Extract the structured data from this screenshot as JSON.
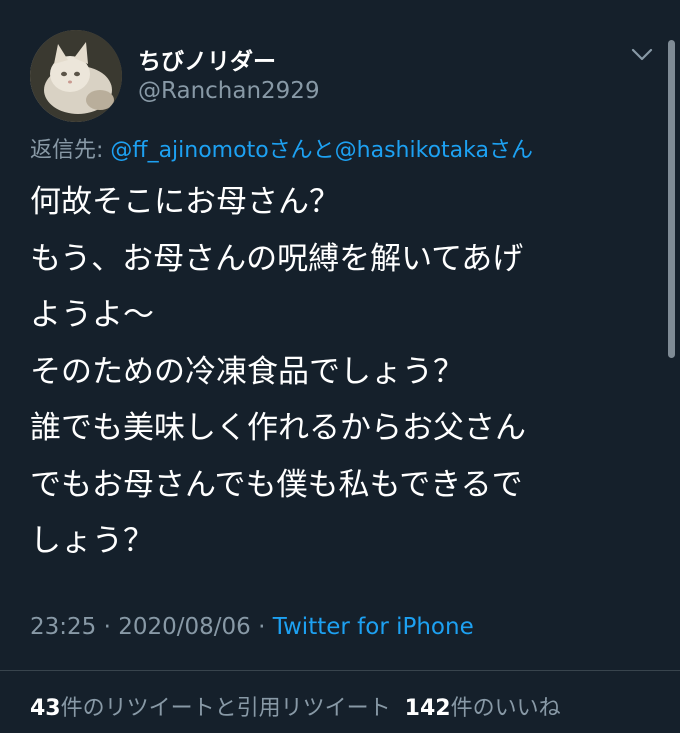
{
  "user": {
    "display_name": "ちびノリダー",
    "handle": "@Ranchan2929"
  },
  "icons": {
    "avatar": "cat-photo-avatar",
    "more": "chevron-down-icon"
  },
  "reply": {
    "prefix": "返信先: ",
    "mention1": "@ff_ajinomoto",
    "san1": "さんと",
    "mention2": "@hashikotaka",
    "san2": "さん"
  },
  "body_lines": [
    "何故そこにお母さん？",
    "もう、お母さんの呪縛を解いてあげ",
    "ようよ〜",
    "そのための冷凍食品でしょう？",
    "誰でも美味しく作れるからお父さん",
    "でもお母さんでも僕も私もできるで",
    "しょう？"
  ],
  "meta": {
    "time": "23:25",
    "sep1": " · ",
    "date": "2020/08/06",
    "sep2": " · ",
    "source": "Twitter for iPhone"
  },
  "stats": {
    "retweets_count": "43",
    "retweets_label": "件のリツイートと引用リツイート",
    "likes_count": "142",
    "likes_label": "件のいいね"
  },
  "colors": {
    "background": "#15202b",
    "link": "#1da1f2",
    "secondary_text": "#8899a6"
  }
}
